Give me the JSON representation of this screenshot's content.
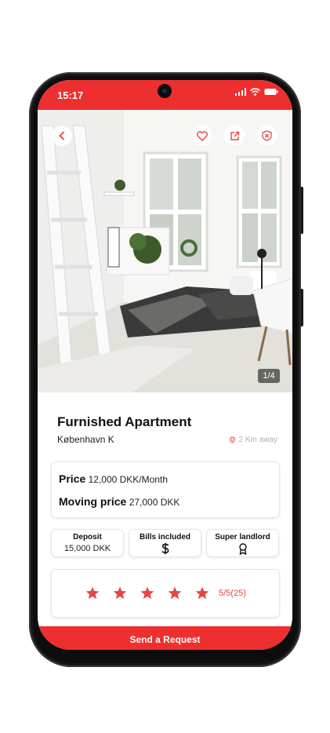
{
  "status_bar": {
    "time": "15:17"
  },
  "photo": {
    "counter": "1/4"
  },
  "listing": {
    "title": "Furnished Apartment",
    "location": "København K",
    "distance": "2 Km away"
  },
  "price": {
    "label": "Price",
    "value": "12,000 DKK/Month",
    "moving_label": "Moving price",
    "moving_value": "27,000 DKK"
  },
  "features": [
    {
      "label": "Deposit",
      "value": "15,000 DKK"
    },
    {
      "label": "Bills included",
      "icon": "dollar-icon"
    },
    {
      "label": "Super landlord",
      "icon": "award-icon"
    }
  ],
  "rating": {
    "stars": 5,
    "text": "5/5(25)"
  },
  "cta": {
    "label": "Send a Request"
  },
  "colors": {
    "accent": "#ee2f2f",
    "star": "#e54545"
  }
}
